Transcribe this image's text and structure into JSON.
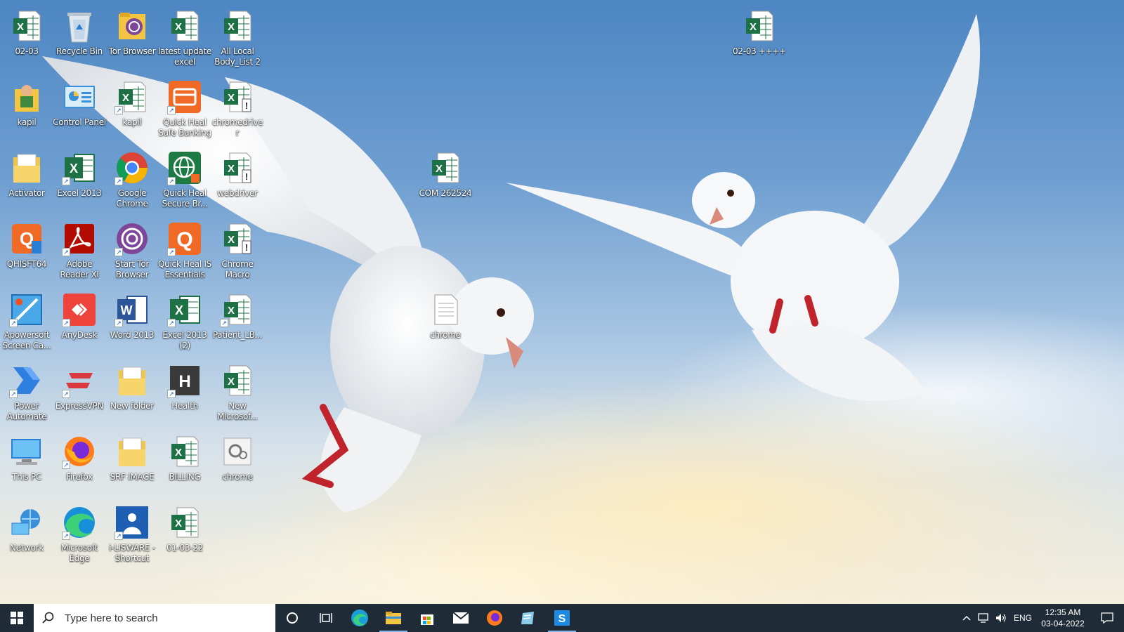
{
  "desktop": {
    "icons": [
      {
        "label": "02-03",
        "type": "excel"
      },
      {
        "label": "Recycle Bin",
        "type": "recycle"
      },
      {
        "label": "Tor Browser",
        "type": "folder-tor"
      },
      {
        "label": "latest update excel",
        "type": "excel"
      },
      {
        "label": "All Local Body_List 2",
        "type": "excel"
      },
      {
        "label": "kapil",
        "type": "user-folder"
      },
      {
        "label": "Control Panel",
        "type": "control-panel"
      },
      {
        "label": "kapil",
        "type": "excel-shortcut"
      },
      {
        "label": "Quick Heal Safe Banking",
        "type": "quickheal-banking"
      },
      {
        "label": "chromedriver",
        "type": "excel-warn"
      },
      {
        "label": "Activator",
        "type": "folder-doc"
      },
      {
        "label": "Excel 2013",
        "type": "excel-app"
      },
      {
        "label": "Google Chrome",
        "type": "chrome"
      },
      {
        "label": "Quick Heal Secure Br...",
        "type": "quickheal-secure"
      },
      {
        "label": "webdriver",
        "type": "excel-warn"
      },
      {
        "label": "QHISFT64",
        "type": "qhisft"
      },
      {
        "label": "Adobe Reader XI",
        "type": "adobe"
      },
      {
        "label": "Start Tor Browser",
        "type": "tor"
      },
      {
        "label": "Quick Heal IS Essentials",
        "type": "quickheal"
      },
      {
        "label": "Chrome Macro",
        "type": "excel-warn"
      },
      {
        "label": "Apowersoft Screen Ca...",
        "type": "apowersoft"
      },
      {
        "label": "AnyDesk",
        "type": "anydesk"
      },
      {
        "label": "Word 2013",
        "type": "word"
      },
      {
        "label": "Excel 2013 (2)",
        "type": "excel-app"
      },
      {
        "label": "Patient_LB...",
        "type": "excel-shortcut"
      },
      {
        "label": "Power Automate",
        "type": "power-automate"
      },
      {
        "label": "ExpressVPN",
        "type": "expressvpn"
      },
      {
        "label": "New folder",
        "type": "folder-doc"
      },
      {
        "label": "Health",
        "type": "health"
      },
      {
        "label": "New Microsof...",
        "type": "excel"
      },
      {
        "label": "This PC",
        "type": "this-pc"
      },
      {
        "label": "Firefox",
        "type": "firefox"
      },
      {
        "label": "SRF IMAGE",
        "type": "folder-doc"
      },
      {
        "label": "BILLING",
        "type": "excel"
      },
      {
        "label": "chrome",
        "type": "settings-file"
      },
      {
        "label": "Network",
        "type": "network"
      },
      {
        "label": "Microsoft Edge",
        "type": "edge"
      },
      {
        "label": "i-LISWARE - Shortcut",
        "type": "lisware"
      },
      {
        "label": "01-03-22",
        "type": "excel"
      },
      {
        "label": "COM 262524",
        "type": "excel"
      },
      {
        "label": "chrome",
        "type": "text-file"
      },
      {
        "label": "02-03 ++++",
        "type": "excel"
      }
    ]
  },
  "taskbar": {
    "search_placeholder": "Type here to search",
    "pinned": [
      "cortana-icon",
      "task-view-icon",
      "edge-icon",
      "file-explorer-icon",
      "microsoft-store-icon",
      "mail-icon",
      "firefox-icon",
      "notepad-icon",
      "liswaresync-icon"
    ],
    "tray": {
      "language": "ENG",
      "time": "12:35 AM",
      "date": "03-04-2022"
    }
  },
  "colors": {
    "taskbar_bg": "#1f2b36",
    "excel_green": "#1e7145",
    "accent": "#7fb2e5"
  }
}
